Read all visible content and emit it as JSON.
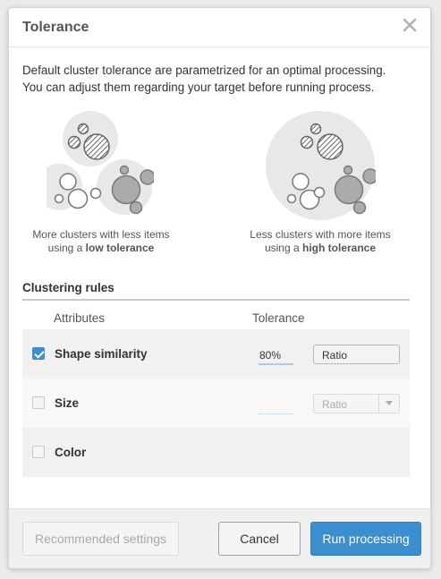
{
  "dialog": {
    "title": "Tolerance",
    "close_icon": "close-x-icon"
  },
  "intro": {
    "line1": "Default cluster tolerance are parametrized for an optimal processing.",
    "line2": "You can adjust them regarding your target before running process."
  },
  "illustrations": {
    "left": {
      "caption_line1": "More clusters with less items",
      "caption_prefix": "using a ",
      "caption_bold": "low tolerance"
    },
    "right": {
      "caption_line1": "Less clusters with more items",
      "caption_prefix": "using a ",
      "caption_bold": "high tolerance"
    }
  },
  "rules": {
    "section_title": "Clustering rules",
    "col_attributes": "Attributes",
    "col_tolerance": "Tolerance",
    "rows": [
      {
        "label": "Shape similarity",
        "checked": true,
        "tolerance": "80%",
        "select": "Ratio",
        "select_enabled": true
      },
      {
        "label": "Size",
        "checked": false,
        "tolerance": "",
        "select": "Ratio",
        "select_enabled": false
      },
      {
        "label": "Color",
        "checked": false
      }
    ]
  },
  "footer": {
    "recommended_label": "Recommended settings",
    "cancel_label": "Cancel",
    "run_label": "Run processing"
  },
  "colors": {
    "primary": "#3a8fd0",
    "checkbox_checked": "#3a8fd6"
  }
}
